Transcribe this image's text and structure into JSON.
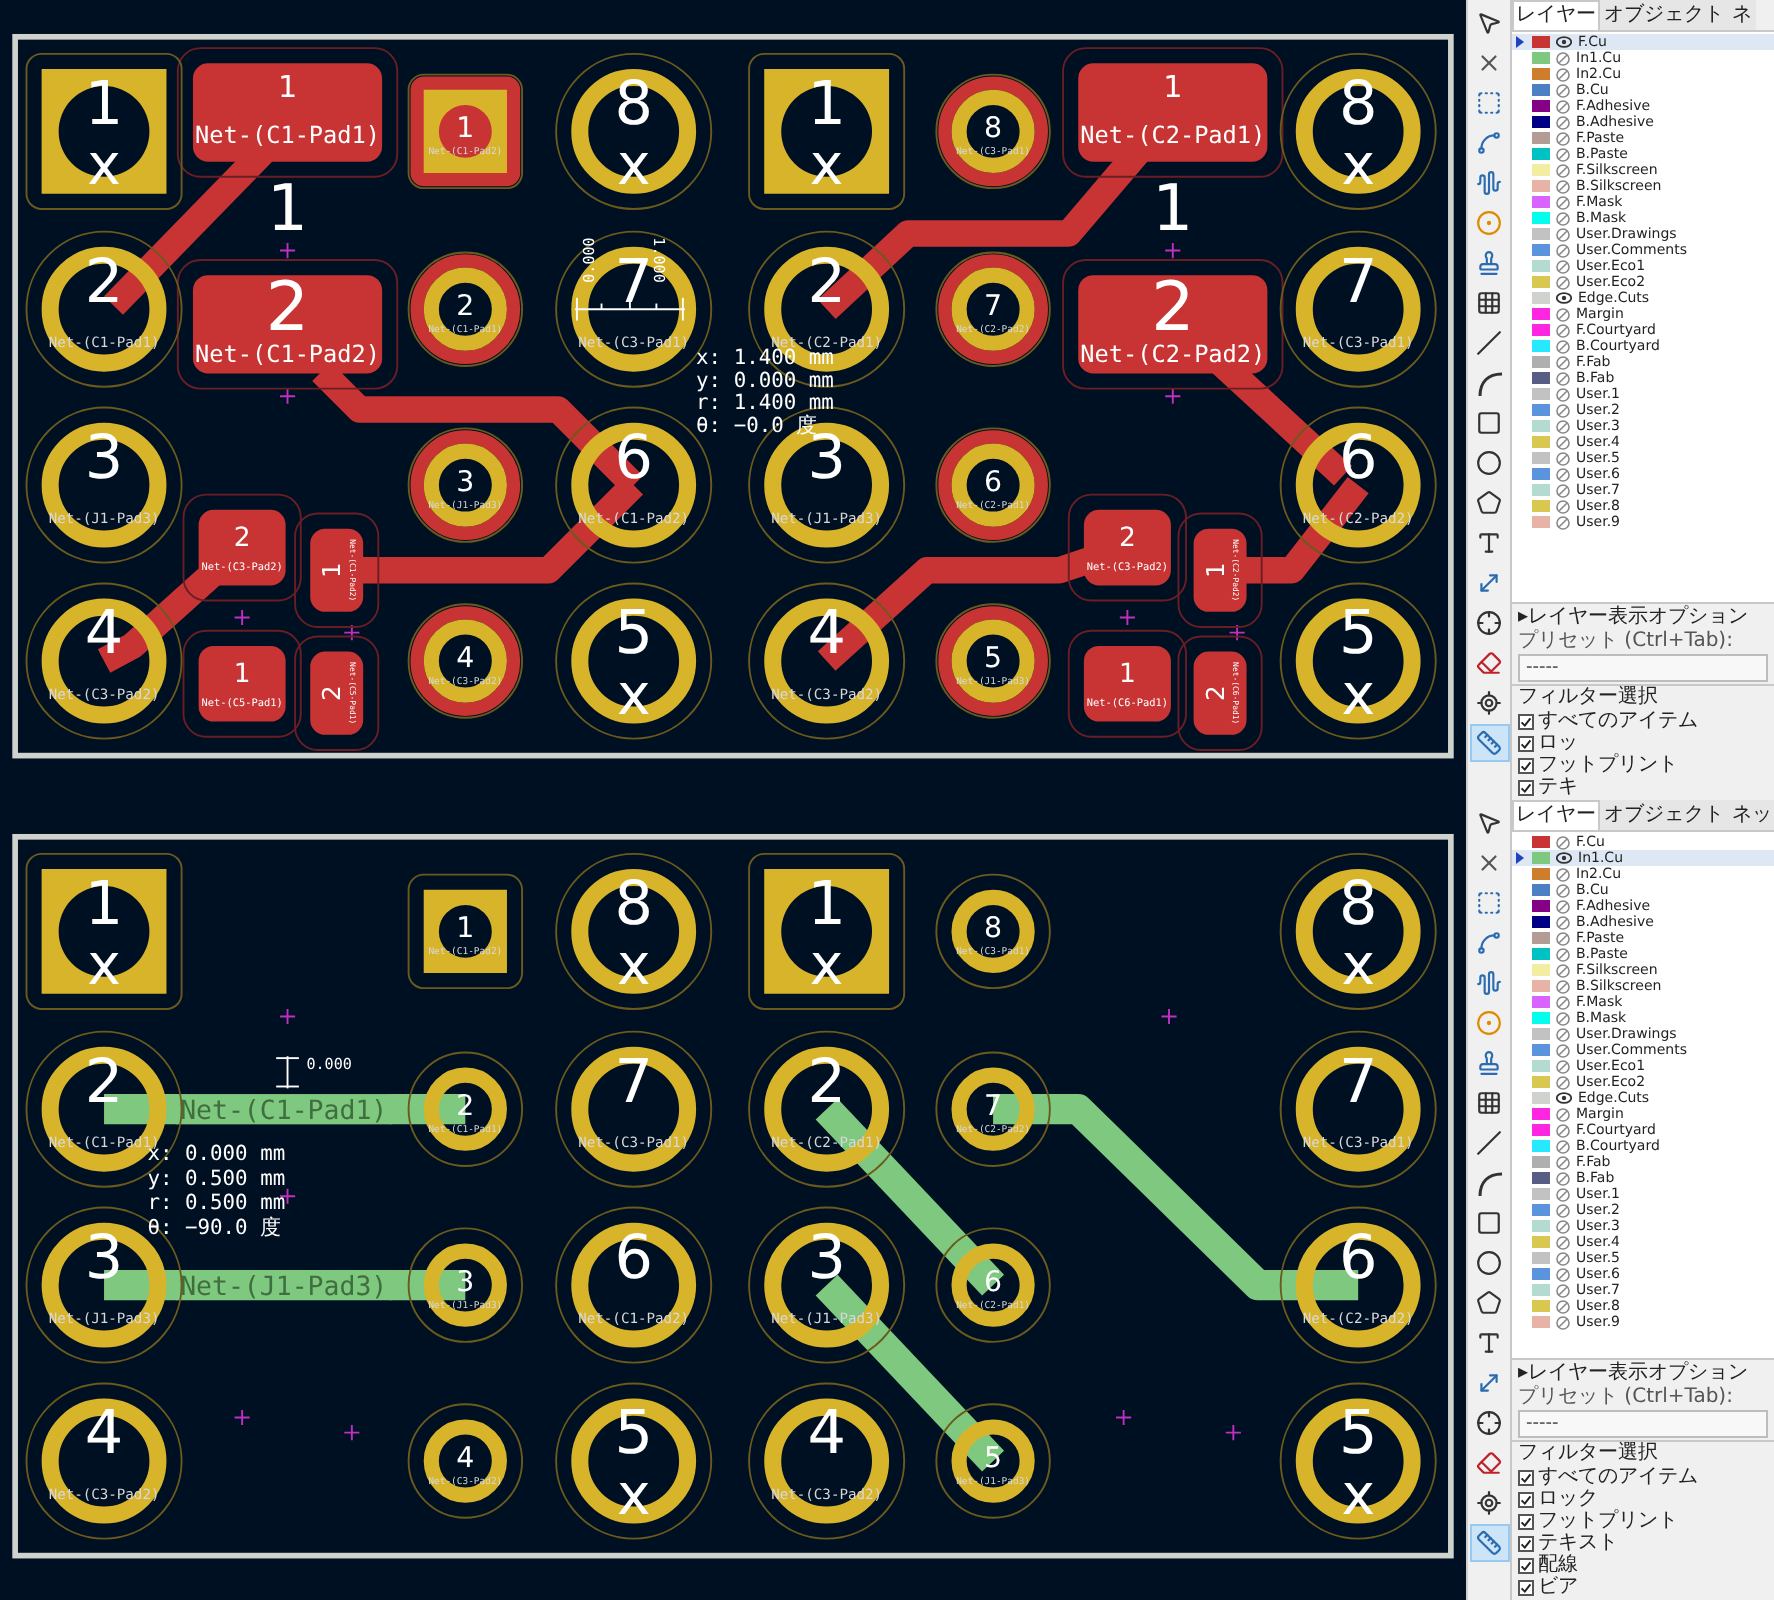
{
  "views": [
    {
      "board": {
        "pads": [
          {
            "number": "1",
            "mark": "x",
            "kind": "square"
          },
          {
            "number": "2",
            "net": "Net-(C1-Pad1)",
            "kind": "round"
          },
          {
            "number": "3",
            "net": "Net-(J1-Pad3)",
            "kind": "round"
          },
          {
            "number": "4",
            "net": "Net-(C3-Pad2)",
            "kind": "round"
          },
          {
            "number": "1",
            "net": "Net-(C1-Pad2)",
            "kind": "small-square",
            "front_copper": true
          },
          {
            "number": "2",
            "net": "Net-(C1-Pad1)",
            "kind": "small-round",
            "front_copper": true
          },
          {
            "number": "3",
            "net": "Net-(J1-Pad3)",
            "kind": "small-round",
            "front_copper": true
          },
          {
            "number": "4",
            "net": "Net-(C3-Pad2)",
            "kind": "small-round",
            "front_copper": true
          },
          {
            "number": "8",
            "mark": "x",
            "kind": "round"
          },
          {
            "number": "7",
            "net": "Net-(C3-Pad1)",
            "kind": "round"
          },
          {
            "number": "6",
            "net": "Net-(C1-Pad2)",
            "kind": "round"
          },
          {
            "number": "5",
            "mark": "x",
            "kind": "round"
          },
          {
            "number": "1",
            "mark": "x",
            "kind": "square"
          },
          {
            "number": "2",
            "net": "Net-(C2-Pad1)",
            "kind": "round"
          },
          {
            "number": "3",
            "net": "Net-(J1-Pad3)",
            "kind": "round"
          },
          {
            "number": "4",
            "net": "Net-(C3-Pad2)",
            "kind": "round"
          },
          {
            "number": "8",
            "net": "Net-(C3-Pad1)",
            "kind": "small-round",
            "front_copper": true
          },
          {
            "number": "7",
            "net": "Net-(C2-Pad2)",
            "kind": "small-round",
            "front_copper": true
          },
          {
            "number": "6",
            "net": "Net-(C2-Pad1)",
            "kind": "small-round",
            "front_copper": true
          },
          {
            "number": "5",
            "net": "Net-(J1-Pad3)",
            "kind": "small-round",
            "front_copper": true
          },
          {
            "number": "8",
            "mark": "x",
            "kind": "round"
          },
          {
            "number": "7",
            "net": "Net-(C3-Pad1)",
            "kind": "round"
          },
          {
            "number": "6",
            "net": "Net-(C2-Pad2)",
            "kind": "round"
          },
          {
            "number": "5",
            "mark": "x",
            "kind": "round"
          }
        ],
        "smd_pads": [
          {
            "kind": "large",
            "number": "1",
            "net": "Net-(C1-Pad1)",
            "ref": "1"
          },
          {
            "kind": "large",
            "net": "Net-(C1-Pad2)",
            "ref": "2"
          },
          {
            "kind": "small",
            "number": "2",
            "net": "Net-(C3-Pad2)"
          },
          {
            "kind": "vertical",
            "number": "1",
            "net": "Net-(C1-Pad2)"
          },
          {
            "kind": "small",
            "number": "1",
            "net": "Net-(C5-Pad1)"
          },
          {
            "kind": "vertical",
            "number": "2",
            "net": "Net-(C5-Pad1)"
          },
          {
            "kind": "large",
            "number": "1",
            "net": "Net-(C2-Pad1)",
            "ref": "1"
          },
          {
            "kind": "large",
            "net": "Net-(C2-Pad2)",
            "ref": "2"
          },
          {
            "kind": "small",
            "number": "2",
            "net": "Net-(C3-Pad2)"
          },
          {
            "kind": "vertical",
            "number": "1",
            "net": "Net-(C2-Pad2)"
          },
          {
            "kind": "small",
            "number": "1",
            "net": "Net-(C6-Pad1)"
          },
          {
            "kind": "vertical",
            "number": "2",
            "net": "Net-(C6-Pad1)"
          }
        ],
        "measurement": {
          "kind": "horizontal",
          "tick_labels": [
            "0.000",
            "1.000"
          ],
          "readout": [
            "x: 1.400 mm",
            "y: 0.000 mm",
            "r: 1.400 mm",
            "θ: −0.0 度"
          ]
        }
      },
      "tools": [
        {
          "selected": false
        },
        {
          "selected": false
        },
        {
          "selected": false
        },
        {
          "selected": false
        },
        {
          "selected": false
        },
        {
          "selected": false
        },
        {
          "selected": false
        },
        {
          "selected": false
        },
        {
          "selected": false
        },
        {
          "selected": false
        },
        {
          "selected": false
        },
        {
          "selected": false
        },
        {
          "selected": false
        },
        {
          "selected": false
        },
        {
          "selected": false
        },
        {
          "selected": false
        },
        {
          "selected": false
        },
        {
          "selected": false
        },
        {
          "selected": true
        }
      ],
      "layers_panel": {
        "tabs": [
          {
            "label": "レイヤー",
            "selected": true
          },
          {
            "label": "オブジェクト",
            "selected": false
          },
          {
            "label": "ネ",
            "selected": false
          }
        ],
        "layers": [
          {
            "name": "F.Cu",
            "color": "#c83434",
            "visible": true,
            "selected": true
          },
          {
            "name": "In1.Cu",
            "color": "#7fc87f",
            "visible": false,
            "selected": false
          },
          {
            "name": "In2.Cu",
            "color": "#ce7d2c",
            "visible": false,
            "selected": false
          },
          {
            "name": "B.Cu",
            "color": "#4d7fc4",
            "visible": false,
            "selected": false
          },
          {
            "name": "F.Adhesive",
            "color": "#840084",
            "visible": false,
            "selected": false
          },
          {
            "name": "B.Adhesive",
            "color": "#000084",
            "visible": false,
            "selected": false
          },
          {
            "name": "F.Paste",
            "color": "#b49c96",
            "visible": false,
            "selected": false
          },
          {
            "name": "B.Paste",
            "color": "#00c2c2",
            "visible": false,
            "selected": false
          },
          {
            "name": "F.Silkscreen",
            "color": "#f2eda1",
            "visible": false,
            "selected": false
          },
          {
            "name": "B.Silkscreen",
            "color": "#e8b2a7",
            "visible": false,
            "selected": false
          },
          {
            "name": "F.Mask",
            "color": "#d864ff",
            "visible": false,
            "selected": false
          },
          {
            "name": "B.Mask",
            "color": "#02ffee",
            "visible": false,
            "selected": false
          },
          {
            "name": "User.Drawings",
            "color": "#c2c2c2",
            "visible": false,
            "selected": false
          },
          {
            "name": "User.Comments",
            "color": "#5994dc",
            "visible": false,
            "selected": false
          },
          {
            "name": "User.Eco1",
            "color": "#b4dbd2",
            "visible": false,
            "selected": false
          },
          {
            "name": "User.Eco2",
            "color": "#d8c852",
            "visible": false,
            "selected": false
          },
          {
            "name": "Edge.Cuts",
            "color": "#d0d2cd",
            "visible": true,
            "selected": false
          },
          {
            "name": "Margin",
            "color": "#ff26e2",
            "visible": false,
            "selected": false
          },
          {
            "name": "F.Courtyard",
            "color": "#ff26e2",
            "visible": false,
            "selected": false
          },
          {
            "name": "B.Courtyard",
            "color": "#26e9ff",
            "visible": false,
            "selected": false
          },
          {
            "name": "F.Fab",
            "color": "#afafaf",
            "visible": false,
            "selected": false
          },
          {
            "name": "B.Fab",
            "color": "#585d84",
            "visible": false,
            "selected": false
          },
          {
            "name": "User.1",
            "color": "#c2c2c2",
            "visible": false,
            "selected": false
          },
          {
            "name": "User.2",
            "color": "#5994dc",
            "visible": false,
            "selected": false
          },
          {
            "name": "User.3",
            "color": "#b4dbd2",
            "visible": false,
            "selected": false
          },
          {
            "name": "User.4",
            "color": "#d8c852",
            "visible": false,
            "selected": false
          },
          {
            "name": "User.5",
            "color": "#c2c2c2",
            "visible": false,
            "selected": false
          },
          {
            "name": "User.6",
            "color": "#5994dc",
            "visible": false,
            "selected": false
          },
          {
            "name": "User.7",
            "color": "#b4dbd2",
            "visible": false,
            "selected": false
          },
          {
            "name": "User.8",
            "color": "#d8c852",
            "visible": false,
            "selected": false
          },
          {
            "name": "User.9",
            "color": "#e8b2a7",
            "visible": false,
            "selected": false
          }
        ],
        "display_options": "▸レイヤー表示オプション",
        "preset_label": "プリセット (Ctrl+Tab):",
        "preset_value": "-----",
        "filter_title": "フィルター選択",
        "filters": [
          {
            "label": "すべてのアイテム",
            "checked": true
          },
          {
            "label": "ロッ",
            "checked": true
          },
          {
            "label": "フットプリント",
            "checked": true
          },
          {
            "label": "テキ",
            "checked": true
          }
        ]
      }
    },
    {
      "board": {
        "pads": [
          {
            "number": "1",
            "mark": "x",
            "kind": "square"
          },
          {
            "number": "2",
            "net": "Net-(C1-Pad1)",
            "kind": "round"
          },
          {
            "number": "3",
            "net": "Net-(J1-Pad3)",
            "kind": "round"
          },
          {
            "number": "4",
            "net": "Net-(C3-Pad2)",
            "kind": "round"
          },
          {
            "number": "1",
            "net": "Net-(C1-Pad2)",
            "kind": "small-square",
            "front_copper": false
          },
          {
            "number": "2",
            "net": "Net-(C1-Pad1)",
            "kind": "small-round",
            "front_copper": false
          },
          {
            "number": "3",
            "net": "Net-(J1-Pad3)",
            "kind": "small-round",
            "front_copper": false
          },
          {
            "number": "4",
            "net": "Net-(C3-Pad2)",
            "kind": "small-round",
            "front_copper": false
          },
          {
            "number": "8",
            "mark": "x",
            "kind": "round"
          },
          {
            "number": "7",
            "net": "Net-(C3-Pad1)",
            "kind": "round"
          },
          {
            "number": "6",
            "net": "Net-(C1-Pad2)",
            "kind": "round"
          },
          {
            "number": "5",
            "mark": "x",
            "kind": "round"
          },
          {
            "number": "1",
            "mark": "x",
            "kind": "square"
          },
          {
            "number": "2",
            "net": "Net-(C2-Pad1)",
            "kind": "round"
          },
          {
            "number": "3",
            "net": "Net-(J1-Pad3)",
            "kind": "round"
          },
          {
            "number": "4",
            "net": "Net-(C3-Pad2)",
            "kind": "round"
          },
          {
            "number": "8",
            "net": "Net-(C3-Pad1)",
            "kind": "small-round",
            "front_copper": false
          },
          {
            "number": "7",
            "net": "Net-(C2-Pad2)",
            "kind": "small-round",
            "front_copper": false
          },
          {
            "number": "6",
            "net": "Net-(C2-Pad1)",
            "kind": "small-round",
            "front_copper": false
          },
          {
            "number": "5",
            "net": "Net-(J1-Pad3)",
            "kind": "small-round",
            "front_copper": false
          },
          {
            "number": "8",
            "mark": "x",
            "kind": "round"
          },
          {
            "number": "7",
            "net": "Net-(C3-Pad1)",
            "kind": "round"
          },
          {
            "number": "6",
            "net": "Net-(C2-Pad2)",
            "kind": "round"
          },
          {
            "number": "5",
            "mark": "x",
            "kind": "round"
          }
        ],
        "trace_labels": [
          "Net-(C1-Pad1)",
          "Net-(J1-Pad3)"
        ],
        "measurement": {
          "kind": "vertical",
          "tick_labels": [
            "0.000"
          ],
          "readout": [
            "x: 0.000 mm",
            "y: 0.500 mm",
            "r: 0.500 mm",
            "θ: −90.0 度"
          ]
        }
      },
      "tools": [
        {
          "selected": false
        },
        {
          "selected": false
        },
        {
          "selected": false
        },
        {
          "selected": false
        },
        {
          "selected": false
        },
        {
          "selected": false
        },
        {
          "selected": false
        },
        {
          "selected": false
        },
        {
          "selected": false
        },
        {
          "selected": false
        },
        {
          "selected": false
        },
        {
          "selected": false
        },
        {
          "selected": false
        },
        {
          "selected": false
        },
        {
          "selected": false
        },
        {
          "selected": false
        },
        {
          "selected": false
        },
        {
          "selected": false
        },
        {
          "selected": true
        }
      ],
      "layers_panel": {
        "tabs": [
          {
            "label": "レイヤー",
            "selected": true
          },
          {
            "label": "オブジェクト",
            "selected": false
          },
          {
            "label": "ネッ",
            "selected": false
          }
        ],
        "layers": [
          {
            "name": "F.Cu",
            "color": "#c83434",
            "visible": false,
            "selected": false
          },
          {
            "name": "In1.Cu",
            "color": "#7fc87f",
            "visible": true,
            "selected": true
          },
          {
            "name": "In2.Cu",
            "color": "#ce7d2c",
            "visible": false,
            "selected": false
          },
          {
            "name": "B.Cu",
            "color": "#4d7fc4",
            "visible": false,
            "selected": false
          },
          {
            "name": "F.Adhesive",
            "color": "#840084",
            "visible": false,
            "selected": false
          },
          {
            "name": "B.Adhesive",
            "color": "#000084",
            "visible": false,
            "selected": false
          },
          {
            "name": "F.Paste",
            "color": "#b49c96",
            "visible": false,
            "selected": false
          },
          {
            "name": "B.Paste",
            "color": "#00c2c2",
            "visible": false,
            "selected": false
          },
          {
            "name": "F.Silkscreen",
            "color": "#f2eda1",
            "visible": false,
            "selected": false
          },
          {
            "name": "B.Silkscreen",
            "color": "#e8b2a7",
            "visible": false,
            "selected": false
          },
          {
            "name": "F.Mask",
            "color": "#d864ff",
            "visible": false,
            "selected": false
          },
          {
            "name": "B.Mask",
            "color": "#02ffee",
            "visible": false,
            "selected": false
          },
          {
            "name": "User.Drawings",
            "color": "#c2c2c2",
            "visible": false,
            "selected": false
          },
          {
            "name": "User.Comments",
            "color": "#5994dc",
            "visible": false,
            "selected": false
          },
          {
            "name": "User.Eco1",
            "color": "#b4dbd2",
            "visible": false,
            "selected": false
          },
          {
            "name": "User.Eco2",
            "color": "#d8c852",
            "visible": false,
            "selected": false
          },
          {
            "name": "Edge.Cuts",
            "color": "#d0d2cd",
            "visible": true,
            "selected": false
          },
          {
            "name": "Margin",
            "color": "#ff26e2",
            "visible": false,
            "selected": false
          },
          {
            "name": "F.Courtyard",
            "color": "#ff26e2",
            "visible": false,
            "selected": false
          },
          {
            "name": "B.Courtyard",
            "color": "#26e9ff",
            "visible": false,
            "selected": false
          },
          {
            "name": "F.Fab",
            "color": "#afafaf",
            "visible": false,
            "selected": false
          },
          {
            "name": "B.Fab",
            "color": "#585d84",
            "visible": false,
            "selected": false
          },
          {
            "name": "User.1",
            "color": "#c2c2c2",
            "visible": false,
            "selected": false
          },
          {
            "name": "User.2",
            "color": "#5994dc",
            "visible": false,
            "selected": false
          },
          {
            "name": "User.3",
            "color": "#b4dbd2",
            "visible": false,
            "selected": false
          },
          {
            "name": "User.4",
            "color": "#d8c852",
            "visible": false,
            "selected": false
          },
          {
            "name": "User.5",
            "color": "#c2c2c2",
            "visible": false,
            "selected": false
          },
          {
            "name": "User.6",
            "color": "#5994dc",
            "visible": false,
            "selected": false
          },
          {
            "name": "User.7",
            "color": "#b4dbd2",
            "visible": false,
            "selected": false
          },
          {
            "name": "User.8",
            "color": "#d8c852",
            "visible": false,
            "selected": false
          },
          {
            "name": "User.9",
            "color": "#e8b2a7",
            "visible": false,
            "selected": false
          }
        ],
        "display_options": "▸レイヤー表示オプション",
        "preset_label": "プリセット (Ctrl+Tab):",
        "preset_value": "-----",
        "filter_title": "フィルター選択",
        "filters": [
          {
            "label": "すべてのアイテム",
            "checked": true
          },
          {
            "label": "ロック",
            "checked": true
          },
          {
            "label": "フットプリント",
            "checked": true
          },
          {
            "label": "テキスト",
            "checked": true
          },
          {
            "label": "配線",
            "checked": true
          },
          {
            "label": "ビア",
            "checked": true
          }
        ]
      }
    }
  ]
}
